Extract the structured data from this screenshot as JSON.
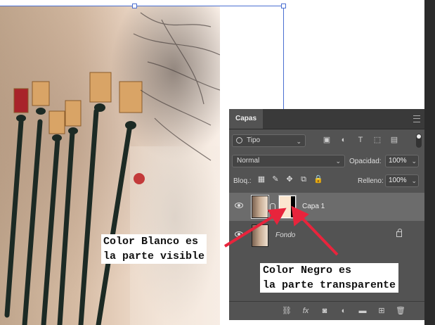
{
  "panel": {
    "tab_label": "Capas",
    "filter": {
      "label": "Tipo"
    },
    "blend_mode": "Normal",
    "opacity_label": "Opacidad:",
    "opacity_value": "100%",
    "lock_label": "Bloq.:",
    "fill_label": "Relleno:",
    "fill_value": "100%",
    "layers": [
      {
        "name": "Capa 1",
        "visible": true,
        "selected": true,
        "has_mask": true
      },
      {
        "name": "Fondo",
        "visible": true,
        "selected": false,
        "locked": true
      }
    ]
  },
  "annotations": {
    "white_line1": "Color Blanco es",
    "white_line2": "la parte visible",
    "black_line1": "Color Negro es",
    "black_line2": "la parte transparente",
    "arrow_color": "#e8243c"
  },
  "colors": {
    "panel_bg": "#535353",
    "selection": "#4a6fd1"
  }
}
